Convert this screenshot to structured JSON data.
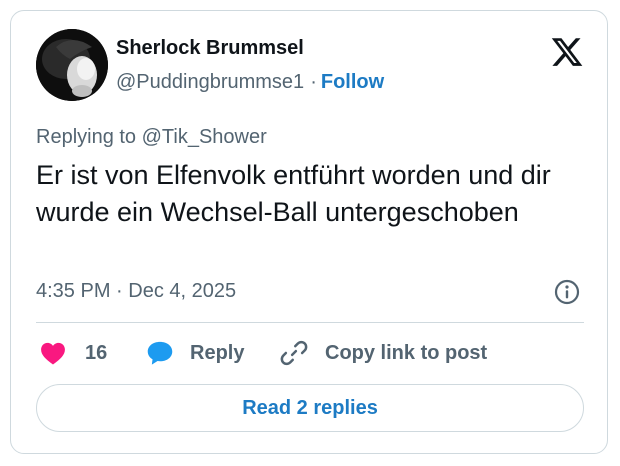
{
  "author": {
    "name": "Sherlock Brummsel",
    "handle": "@Puddingbrummse1",
    "separator": "·",
    "follow_label": "Follow"
  },
  "reply_context": "Replying to @Tik_Shower",
  "tweet": {
    "text": "Er ist von Elfenvolk entführt worden und dir wurde ein Wechsel-Ball untergeschoben",
    "timestamp": "4:35 PM · Dec 4, 2025"
  },
  "actions": {
    "like_count": "16",
    "reply_label": "Reply",
    "copy_link_label": "Copy link to post"
  },
  "read_replies_label": "Read 2 replies",
  "icons": {
    "brand": "x-logo-icon",
    "info": "info-icon",
    "like": "heart-icon",
    "reply": "speech-bubble-icon",
    "copy_link": "link-icon"
  },
  "colors": {
    "accent": "#1d7bc4",
    "heart": "#f91880",
    "muted_text": "#536471",
    "border": "#cfd9de"
  }
}
